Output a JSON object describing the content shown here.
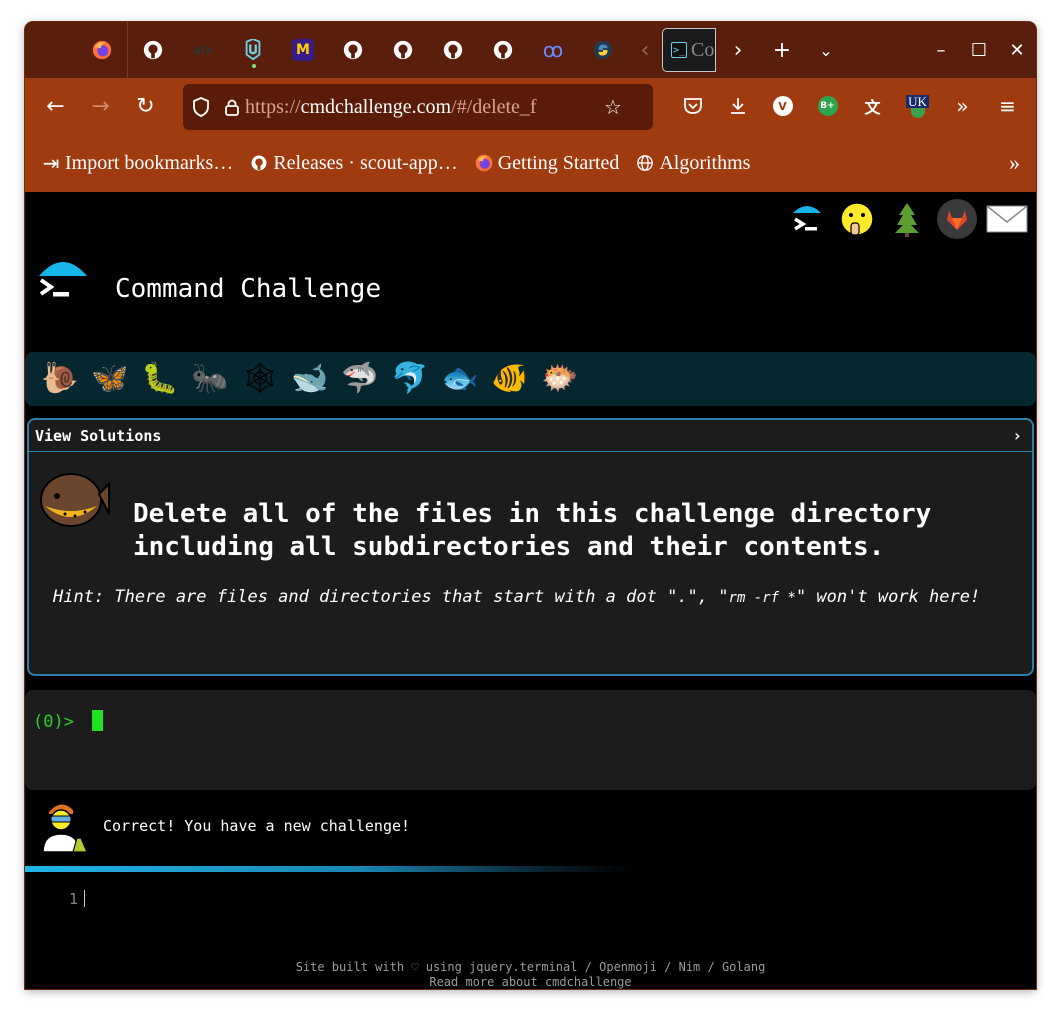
{
  "browser": {
    "pinned_tabs": [
      {
        "icon": "firefox-icon"
      },
      {
        "icon": "github-icon"
      },
      {
        "icon": "alx-icon",
        "label": "alx"
      },
      {
        "icon": "udacity-icon"
      },
      {
        "icon": "medium-icon",
        "label": "M"
      },
      {
        "icon": "github-icon"
      },
      {
        "icon": "github-icon"
      },
      {
        "icon": "github-icon"
      },
      {
        "icon": "github-icon"
      },
      {
        "icon": "infinity-icon",
        "label": "ꝏ"
      },
      {
        "icon": "python-icon"
      }
    ],
    "active_tab": {
      "title": "Co",
      "icon": "terminal-icon"
    },
    "url_prefix": "https://",
    "url_host": "cmdchallenge.com",
    "url_path": "/#/delete_f",
    "extensions": [
      {
        "icon": "pocket-icon"
      },
      {
        "icon": "download-icon"
      },
      {
        "icon": "v-extension-icon",
        "label": "V"
      },
      {
        "icon": "bplus-extension-icon",
        "label": "B+"
      },
      {
        "icon": "translate-icon"
      },
      {
        "icon": "uk-extension-icon",
        "label": "UK"
      },
      {
        "icon": "more-tools-icon"
      },
      {
        "icon": "menu-icon"
      }
    ],
    "bookmarks": [
      {
        "label": "Import  bookmarks…",
        "icon": "import-icon"
      },
      {
        "label": "Releases  ·  scout-app…",
        "icon": "github-icon"
      },
      {
        "label": "Getting  Started",
        "icon": "firefox-icon"
      },
      {
        "label": "Algorithms",
        "icon": "globe-icon"
      }
    ]
  },
  "page": {
    "top_icons": [
      "terminal-logo-icon",
      "shushing-face-icon",
      "tree-icon",
      "gitlab-icon",
      "mail-icon"
    ],
    "title": "Command Challenge",
    "levels": [
      "🐌",
      "🦋",
      "🐛",
      "🐜",
      "🕸",
      "🐋",
      "🦈",
      "🐬",
      "🐟",
      "🐠",
      "🐡"
    ],
    "challenge": {
      "header": "View Solutions",
      "chevron": "›",
      "text": "Delete all of the files in this challenge directory including all subdirectories and their contents.",
      "hint_before": "Hint: There are files and directories that start with a dot \".\", \"",
      "hint_code": "rm -rf *",
      "hint_after": "\" won't work here!"
    },
    "terminal": {
      "prompt": "(0)> "
    },
    "message": "Correct! You have a new challenge!",
    "editor": {
      "line_number": "1"
    },
    "footer": {
      "line1": "Site built with ♡ using jquery.terminal / Openmoji / Nim / Golang",
      "line2": "Read more about cmdchallenge"
    }
  }
}
